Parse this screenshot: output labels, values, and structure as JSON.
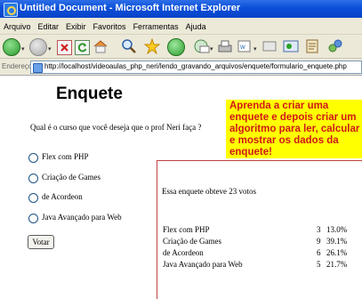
{
  "window": {
    "title": "Untitled Document - Microsoft Internet Explorer"
  },
  "menu": [
    "Arquivo",
    "Editar",
    "Exibir",
    "Favoritos",
    "Ferramentas",
    "Ajuda"
  ],
  "address": {
    "label": "Endereço",
    "url": "http://localhost/videoaulas_php_neri/lendo_gravando_arquivos/enquete/formulario_enquete.php"
  },
  "page": {
    "heading": "Enquete",
    "question": "Qual é o curso que você deseja que o prof Neri faça ?",
    "options": [
      "Flex com PHP",
      "Criação de Games",
      "de Acordeon",
      "Java Avançado para Web"
    ],
    "submit_label": "Votar",
    "callout": "Aprenda a criar uma enquete e depois criar um algoritmo para ler, calcular e mostrar os dados da enquete!",
    "results": {
      "summary": "Essa enquete obteve 23 votos",
      "rows": [
        {
          "name": "Flex com PHP",
          "count": "3",
          "percent": "13.0%"
        },
        {
          "name": "Criação de Games",
          "count": "9",
          "percent": "39.1%"
        },
        {
          "name": "de Acordeon",
          "count": "6",
          "percent": "26.1%"
        },
        {
          "name": "Java Avançado para Web",
          "count": "5",
          "percent": "21.7%"
        }
      ]
    }
  },
  "colors": {
    "callout_bg": "#ffff00",
    "callout_text": "#d01818",
    "titlebar": "#0a4fd8"
  }
}
